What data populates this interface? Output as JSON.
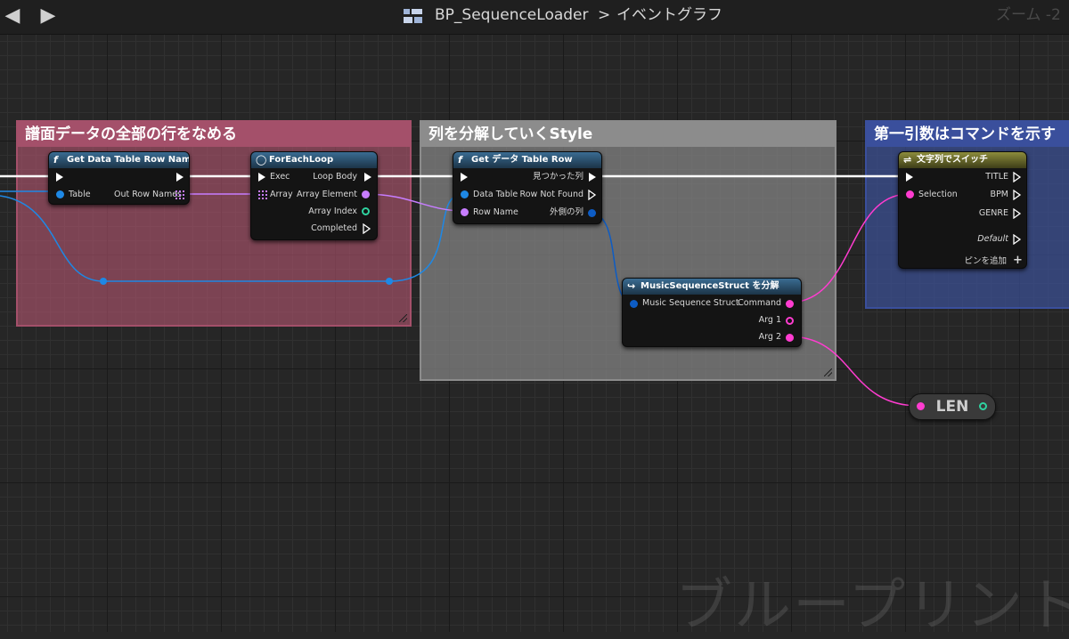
{
  "header": {
    "breadcrumb_asset": "BP_SequenceLoader",
    "breadcrumb_sep": ">",
    "breadcrumb_graph": "イベントグラフ",
    "zoom": "ズーム -2"
  },
  "comments": [
    {
      "title": "譜面データの全部の行をなめる",
      "color": "#a4506a"
    },
    {
      "title": "列を分解していくStyle",
      "color": "#8c8c8c"
    },
    {
      "title": "第一引数はコマンドを示す",
      "color": "#3a4f9c"
    }
  ],
  "nodes": {
    "get_row_names": {
      "title": "Get Data Table Row Names",
      "pin_table": "Table",
      "pin_out": "Out Row Names"
    },
    "foreach": {
      "title": "ForEachLoop",
      "pin_exec": "Exec",
      "pin_array": "Array",
      "pin_loop_body": "Loop Body",
      "pin_element": "Array Element",
      "pin_index": "Array Index",
      "pin_completed": "Completed"
    },
    "get_row": {
      "title": "Get データ Table Row",
      "pin_data_table": "Data Table",
      "pin_row_name": "Row Name",
      "pin_found": "見つかった列",
      "pin_not_found": "Row Not Found",
      "pin_out_row": "外側の列"
    },
    "break_struct": {
      "title": "MusicSequenceStruct を分解",
      "pin_in": "Music Sequence Struct",
      "pin_command": "Command",
      "pin_arg1": "Arg 1",
      "pin_arg2": "Arg 2"
    },
    "switch": {
      "title": "文字列でスイッチ",
      "pin_selection": "Selection",
      "case_title": "TITLE",
      "case_bpm": "BPM",
      "case_genre": "GENRE",
      "case_default": "Default",
      "add_pin": "ピンを追加"
    },
    "len": {
      "title": "LEN"
    }
  },
  "watermark": "ブループリント",
  "colors": {
    "exec": "#ffffff",
    "object": "#1e88e5",
    "name": "#c77dff",
    "int": "#2fd3a0",
    "string": "#ff3cd0",
    "struct": "#0d5cc4"
  }
}
